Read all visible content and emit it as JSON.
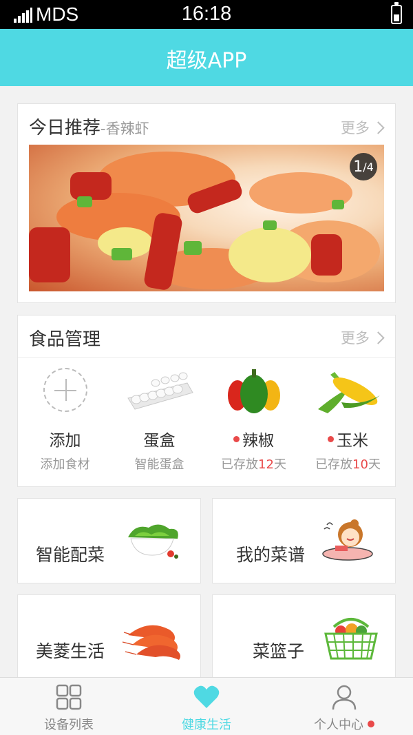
{
  "status_bar": {
    "carrier": "MDS",
    "time": "16:18"
  },
  "app_bar": {
    "title": "超级APP"
  },
  "today": {
    "title": "今日推荐",
    "subtitle": "-香辣虾",
    "more": "更多",
    "pager_current": "1",
    "pager_total": "/4"
  },
  "food": {
    "title": "食品管理",
    "more": "更多",
    "items": [
      {
        "name": "添加",
        "desc": "添加食材"
      },
      {
        "name": "蛋盒",
        "desc": "智能蛋盒"
      },
      {
        "name": "辣椒",
        "desc_prefix": "已存放",
        "days": "12",
        "desc_suffix": "天"
      },
      {
        "name": "玉米",
        "desc_prefix": "已存放",
        "days": "10",
        "desc_suffix": "天"
      }
    ]
  },
  "tiles": [
    {
      "label": "智能配菜",
      "icon": "salad-bowl-icon"
    },
    {
      "label": "我的菜谱",
      "icon": "girl-eating-icon"
    },
    {
      "label": "美菱生活",
      "icon": "shrimp-icon"
    },
    {
      "label": "菜篮子",
      "icon": "vegetable-basket-icon"
    }
  ],
  "tabbar": {
    "tabs": [
      {
        "label": "设备列表",
        "icon": "grid-icon"
      },
      {
        "label": "健康生活",
        "icon": "heart-icon",
        "active": true
      },
      {
        "label": "个人中心",
        "icon": "person-icon",
        "badge": true
      }
    ]
  },
  "colors": {
    "accent": "#4fd9e3",
    "badge": "#e94a4a"
  }
}
